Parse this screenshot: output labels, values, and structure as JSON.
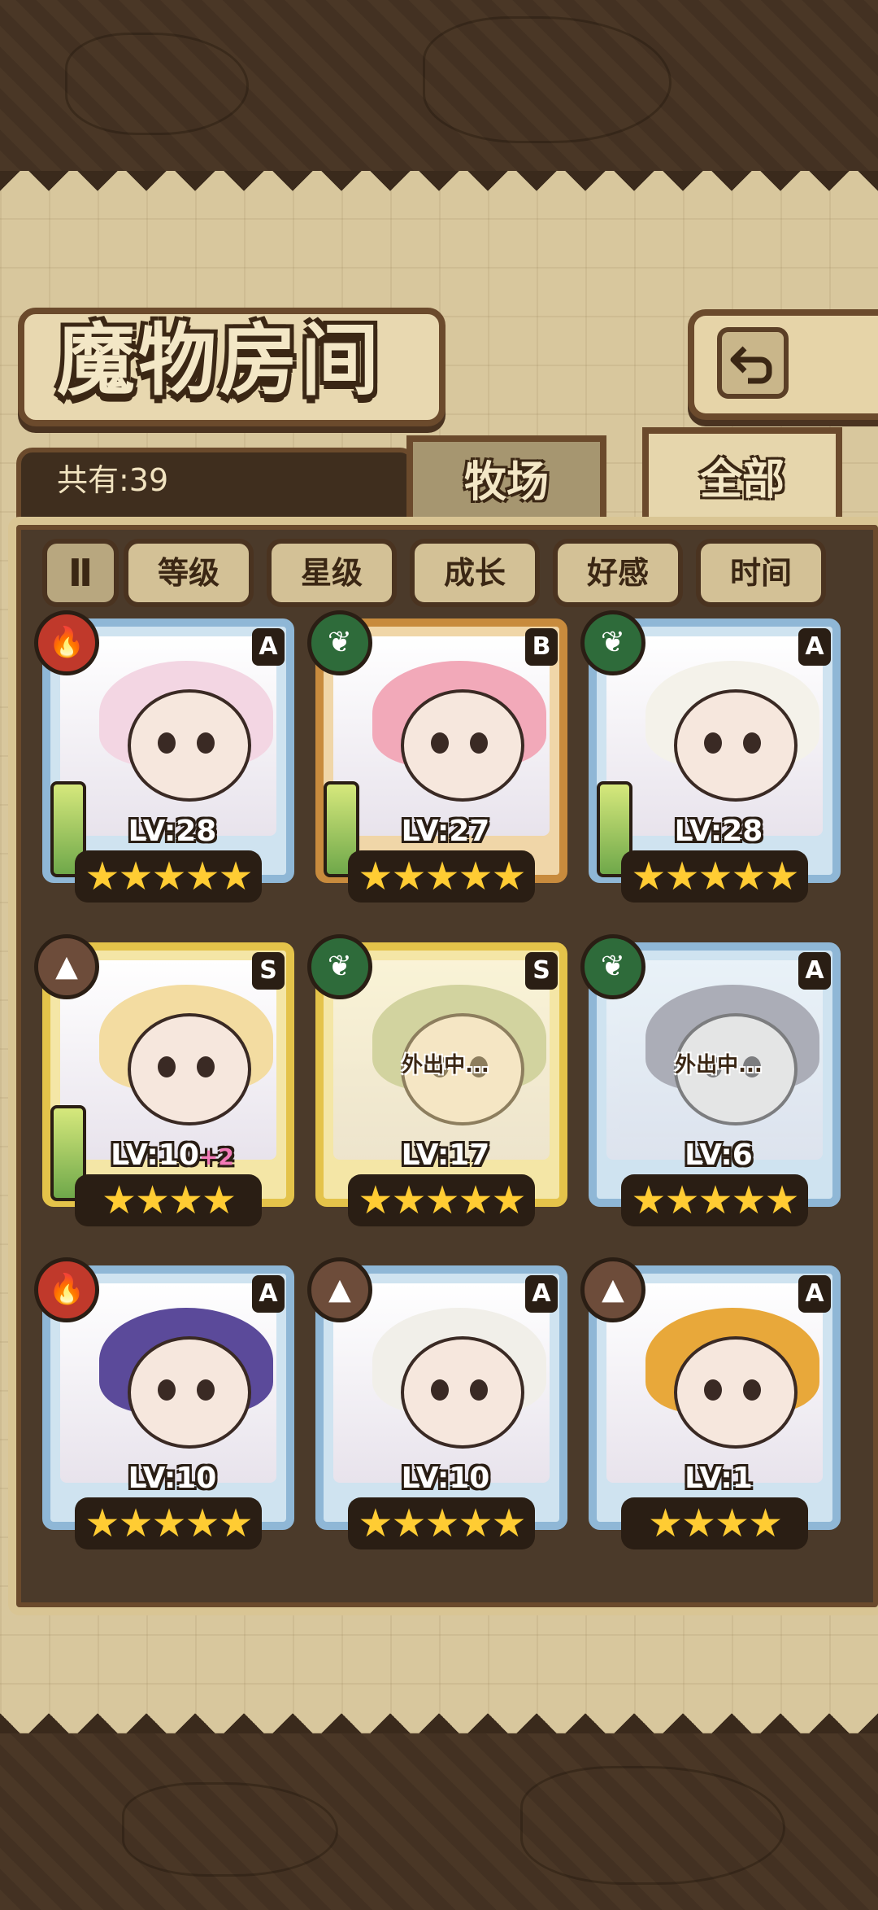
{
  "header": {
    "title": "魔物房间",
    "back_icon": "back-arrow-icon"
  },
  "summary": {
    "count_label": "共有:39"
  },
  "tabs": [
    {
      "label": "牧场",
      "active": false
    },
    {
      "label": "全部",
      "active": true
    }
  ],
  "filters": {
    "toggle_label": "Ⅱ",
    "sort_buttons": [
      "等级",
      "星级",
      "成长",
      "好感",
      "时间"
    ]
  },
  "monsters": [
    {
      "element": "fire",
      "element_icon": "fire-icon",
      "rank": "A",
      "level": "LV:28",
      "bonus": "",
      "stars": "★★★★★",
      "frame": "blue",
      "status": "",
      "hair": "#f3d6e3"
    },
    {
      "element": "leaf",
      "element_icon": "leaf-icon",
      "rank": "B",
      "level": "LV:27",
      "bonus": "",
      "stars": "★★★★★",
      "frame": "bronze",
      "status": "",
      "hair": "#f2a9b9"
    },
    {
      "element": "leaf",
      "element_icon": "leaf-icon",
      "rank": "A",
      "level": "LV:28",
      "bonus": "",
      "stars": "★★★★★",
      "frame": "blue",
      "status": "",
      "hair": "#f4f2ea"
    },
    {
      "element": "earth",
      "element_icon": "mountain-icon",
      "rank": "S",
      "level": "LV:10",
      "bonus": "+2",
      "stars": "★★★★",
      "frame": "gold",
      "status": "",
      "hair": "#f3dca1"
    },
    {
      "element": "leaf",
      "element_icon": "leaf-icon",
      "rank": "S",
      "level": "LV:17",
      "bonus": "",
      "stars": "★★★★★",
      "frame": "gold",
      "status": "外出中...",
      "hair": "#b8c49a"
    },
    {
      "element": "leaf",
      "element_icon": "leaf-icon",
      "rank": "A",
      "level": "LV:6",
      "bonus": "",
      "stars": "★★★★★",
      "frame": "blue",
      "status": "外出中...",
      "hair": "#8f8289"
    },
    {
      "element": "fire",
      "element_icon": "fire-icon",
      "rank": "A",
      "level": "LV:10",
      "bonus": "",
      "stars": "★★★★★",
      "frame": "blue",
      "status": "",
      "hair": "#5b4a9a"
    },
    {
      "element": "earth",
      "element_icon": "mountain-icon",
      "rank": "A",
      "level": "LV:10",
      "bonus": "",
      "stars": "★★★★★",
      "frame": "blue",
      "status": "",
      "hair": "#f1efe9"
    },
    {
      "element": "earth",
      "element_icon": "mountain-icon",
      "rank": "A",
      "level": "LV:1",
      "bonus": "",
      "stars": "★★★★",
      "frame": "blue",
      "status": "",
      "hair": "#e8a83a"
    }
  ]
}
